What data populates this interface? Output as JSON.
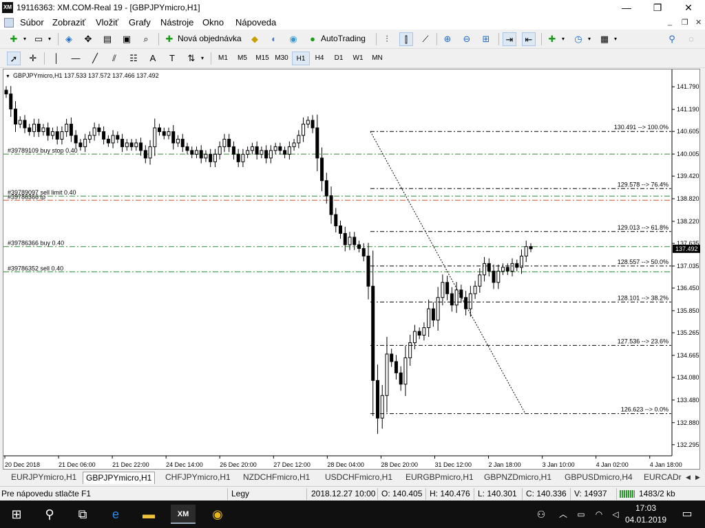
{
  "window": {
    "title": "19116363: XM.COM-Real 19 - [GBPJPYmicro,H1]",
    "logo": "XM",
    "minimize_icon": "—",
    "maximize_icon": "❐",
    "close_icon": "✕"
  },
  "menu": {
    "items": [
      "Súbor",
      "Zobraziť",
      "Vložiť",
      "Grafy",
      "Nástroje",
      "Okno",
      "Nápoveda"
    ]
  },
  "toolbar": {
    "new_order": "Nová objednávka",
    "autotrading": "AutoTrading"
  },
  "timeframes": [
    "M1",
    "M5",
    "M15",
    "M30",
    "H1",
    "H4",
    "D1",
    "W1",
    "MN"
  ],
  "timeframe_active": "H1",
  "chart": {
    "header": "GBPJPYmicro,H1  137.533 137.572 137.466 137.492",
    "current_price": "137.492",
    "y_labels": [
      "141.790",
      "141.190",
      "140.605",
      "140.005",
      "139.420",
      "138.820",
      "138.220",
      "137.635",
      "137.035",
      "136.450",
      "135.850",
      "135.265",
      "134.665",
      "134.080",
      "133.480",
      "132.880",
      "132.295"
    ],
    "x_labels": [
      "20 Dec 2018",
      "21 Dec 06:00",
      "21 Dec 22:00",
      "24 Dec 14:00",
      "26 Dec 20:00",
      "27 Dec 12:00",
      "28 Dec 04:00",
      "28 Dec 20:00",
      "31 Dec 12:00",
      "2 Jan 18:00",
      "3 Jan 10:00",
      "4 Jan 02:00",
      "4 Jan 18:00"
    ],
    "order_lines": [
      {
        "label": "#39789109 buy stop 0.40",
        "price": 140.005,
        "color": "#2e8b2e"
      },
      {
        "label": "#39789097 sell limit 0.40",
        "price": 138.89,
        "color": "#2e8b2e"
      },
      {
        "label": "#39786366 tp",
        "price": 138.78,
        "color": "#d9532c"
      },
      {
        "label": "#39786366 buy 0.40",
        "price": 137.55,
        "color": "#2e8b2e"
      },
      {
        "label": "#39786352 sell 0.40",
        "price": 136.88,
        "color": "#2e8b2e"
      }
    ],
    "fib_levels": [
      {
        "label": "130.491 --> 100.0%",
        "price": 140.605
      },
      {
        "label": "129.578 --> 76.4%",
        "price": 139.09
      },
      {
        "label": "129.013 --> 61.8%",
        "price": 137.95
      },
      {
        "label": "128.557 --> 50.0%",
        "price": 137.035
      },
      {
        "label": "128.101 --> 38.2%",
        "price": 136.08
      },
      {
        "label": "127.536 --> 23.6%",
        "price": 134.93
      },
      {
        "label": "126.623 --> 0.0%",
        "price": 133.12
      }
    ]
  },
  "chart_data": {
    "type": "candlestick",
    "title": "GBPJPYmicro,H1",
    "ylim": [
      132.0,
      142.25
    ],
    "ohlc_last": {
      "open": 137.533,
      "high": 137.572,
      "low": 137.466,
      "close": 137.492
    },
    "closes": [
      141.6,
      141.2,
      140.8,
      140.9,
      140.7,
      140.6,
      140.8,
      140.6,
      140.7,
      140.5,
      140.6,
      140.4,
      140.6,
      140.8,
      140.5,
      140.3,
      140.2,
      140.4,
      140.5,
      140.7,
      140.6,
      140.4,
      140.3,
      140.5,
      140.4,
      140.2,
      140.3,
      140.2,
      140.3,
      140.1,
      139.9,
      140.2,
      140.7,
      140.6,
      140.5,
      140.6,
      140.3,
      140.4,
      140.2,
      140.1,
      140.0,
      140.1,
      139.9,
      140.0,
      139.8,
      140.0,
      140.2,
      140.4,
      140.2,
      140.0,
      139.8,
      140.0,
      140.1,
      140.2,
      140.0,
      140.1,
      139.9,
      140.1,
      140.2,
      140.1,
      140.0,
      140.2,
      140.3,
      140.5,
      140.8,
      140.9,
      140.7,
      139.9,
      139.3,
      138.9,
      138.4,
      138.1,
      137.9,
      137.6,
      137.8,
      137.6,
      137.5,
      137.3,
      136.5,
      134.0,
      133.0,
      133.6,
      134.7,
      134.5,
      134.2,
      133.9,
      134.6,
      135.0,
      135.3,
      135.2,
      135.4,
      135.9,
      135.6,
      136.2,
      136.6,
      136.3,
      136.0,
      136.4,
      136.2,
      135.9,
      136.3,
      136.5,
      136.8,
      137.1,
      136.9,
      136.6,
      136.9,
      137.0,
      136.9,
      137.1,
      137.0,
      137.3,
      137.55,
      137.492
    ]
  },
  "tabs": {
    "items": [
      "EURJPYmicro,H1",
      "GBPJPYmicro,H1",
      "CHFJPYmicro,H1",
      "NZDCHFmicro,H1",
      "USDCHFmicro,H1",
      "EURGBPmicro,H1",
      "GBPNZDmicro,H1",
      "GBPUSDmicro,H4",
      "EURCADr"
    ],
    "active": 1
  },
  "status": {
    "help": "Pre nápovedu stlačte F1",
    "profile": "Legy",
    "datetime": "2018.12.27 10:00",
    "open": "O: 140.405",
    "high": "H: 140.476",
    "low": "L: 140.301",
    "close": "C: 140.336",
    "volume": "V: 14937",
    "traffic": "1483/2 kb"
  },
  "taskbar": {
    "time": "17:03",
    "date": "04.01.2019",
    "xm_label": "XM"
  }
}
